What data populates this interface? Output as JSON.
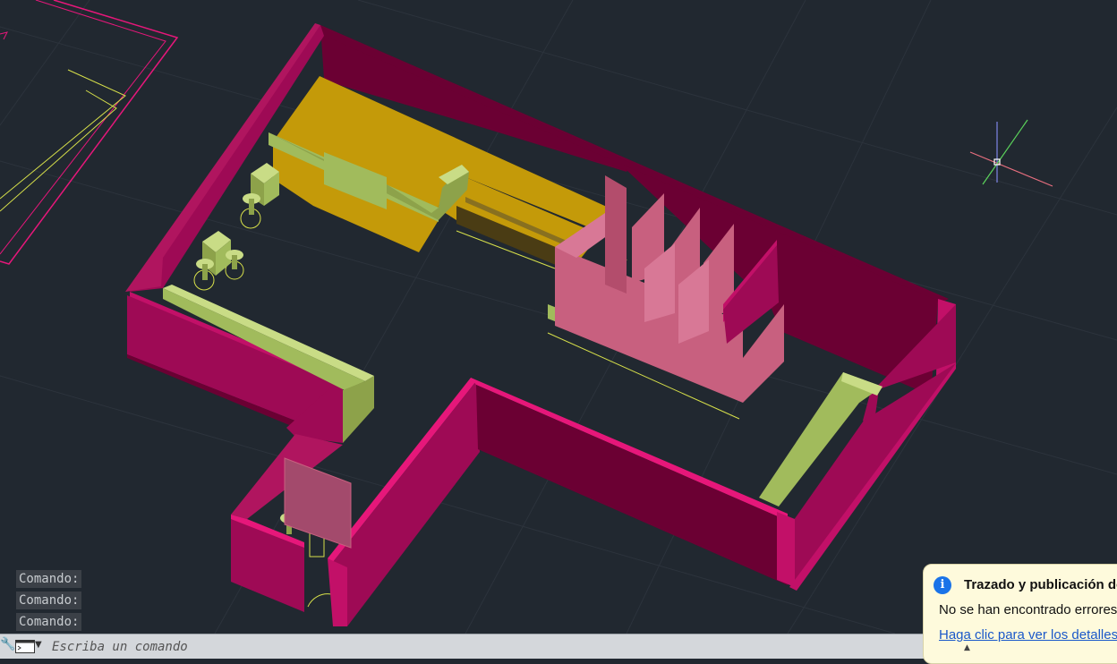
{
  "command_history": [
    "Comando:",
    "Comando:",
    "Comando:"
  ],
  "command_bar": {
    "placeholder": "Escriba un comando",
    "wrench_icon": "wrench-icon",
    "prompt_icon": "command-prompt-icon",
    "dropdown_icon": "chevron-down-icon"
  },
  "notification": {
    "icon": "info-icon",
    "icon_glyph": "i",
    "title": "Trazado y publicación de",
    "message": "No se han encontrado errores",
    "link": "Haga clic para ver los detalles"
  },
  "viewport": {
    "background": "#212830",
    "colors": {
      "wall": "#9e0a55",
      "wall_dark": "#6b0033",
      "wall_edge": "#e6177a",
      "counter": "#c49a09",
      "furniture": "#a1bb5c",
      "partition": "#c8607f",
      "construction_line": "#d7e04a"
    }
  }
}
